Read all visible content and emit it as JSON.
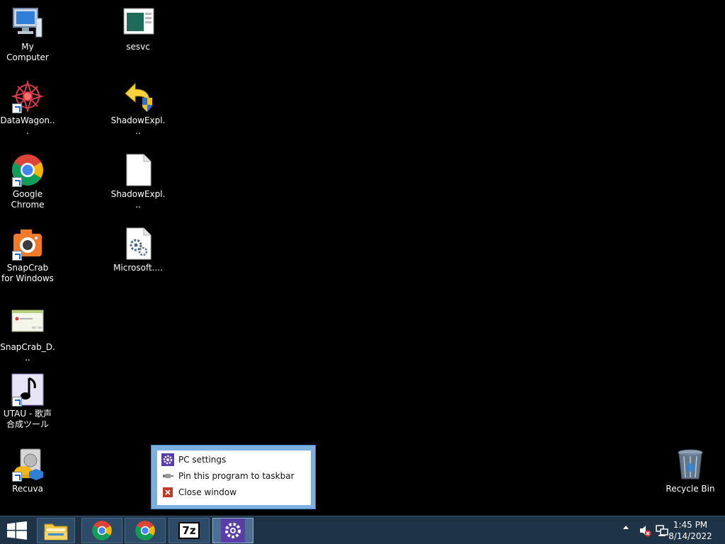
{
  "desktop": {
    "icons": [
      {
        "label": "My Computer"
      },
      {
        "label": "DataWagon..."
      },
      {
        "label": "Google Chrome"
      },
      {
        "label": "SnapCrab for Windows"
      },
      {
        "label": "SnapCrab_D..."
      },
      {
        "label": "UTAU - 歌声合成ツール"
      },
      {
        "label": "Recuva"
      },
      {
        "label": "sesvc"
      },
      {
        "label": "ShadowExpl..."
      },
      {
        "label": "ShadowExpl..."
      },
      {
        "label": "Microsoft...."
      },
      {
        "label": "Recycle Bin"
      }
    ]
  },
  "jumplist": {
    "items": [
      {
        "label": "PC settings",
        "icon": "gear-icon"
      },
      {
        "label": "Pin this program to taskbar",
        "icon": "pin-icon"
      },
      {
        "label": "Close window",
        "icon": "close-icon"
      }
    ]
  },
  "taskbar": {
    "buttons": [
      {
        "name": "file-explorer",
        "icon": "folder-icon"
      },
      {
        "name": "chrome-1",
        "icon": "chrome-icon"
      },
      {
        "name": "chrome-2",
        "icon": "chrome-icon"
      },
      {
        "name": "7zip",
        "icon": "7zip-icon",
        "text": "7z"
      },
      {
        "name": "pc-settings",
        "icon": "gear-icon",
        "active": true
      }
    ],
    "clock": {
      "time": "1:45 PM",
      "date": "8/14/2022"
    }
  },
  "colors": {
    "taskbar": "#1f3347",
    "jumplist_frame": "#7bb0e0",
    "settings_purple": "#5a3ea8"
  }
}
